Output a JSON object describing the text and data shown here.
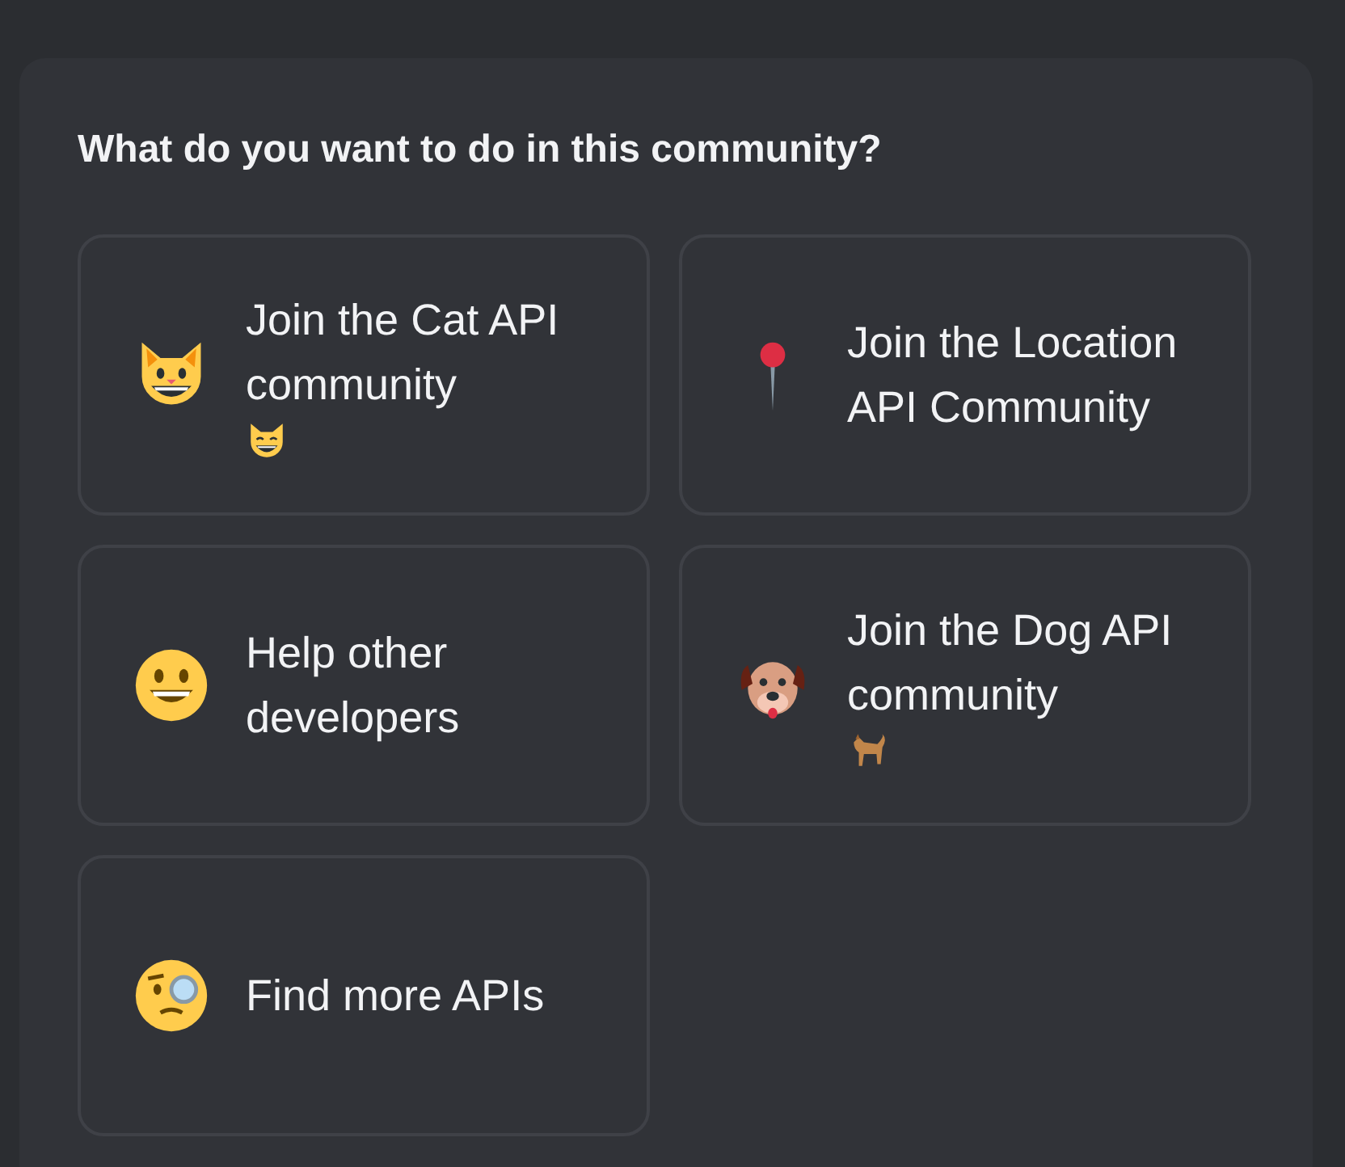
{
  "prompt": "What do you want to do in this community?",
  "options": [
    {
      "label": "Join the Cat API community"
    },
    {
      "label": "Join the Location API Community"
    },
    {
      "label": "Help other developers"
    },
    {
      "label": "Join the Dog API community"
    },
    {
      "label": "Find more APIs"
    }
  ]
}
